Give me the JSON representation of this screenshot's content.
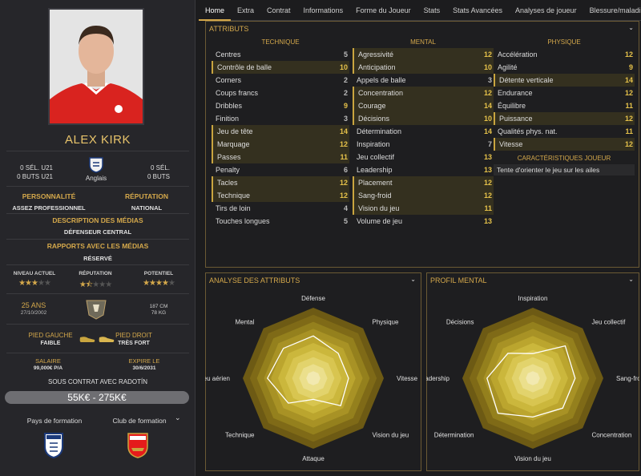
{
  "player": {
    "name": "ALEX KIRK",
    "nationality": "Anglais",
    "u21_caps": "0 SÉL. U21",
    "u21_goals": "0 BUTS U21",
    "caps": "0 SÉL.",
    "goals": "0 BUTS"
  },
  "personality": {
    "label": "PERSONNALITÉ",
    "value": "ASSEZ PROFESSIONNEL"
  },
  "reputation": {
    "label": "RÉPUTATION",
    "value": "NATIONAL"
  },
  "media_desc": {
    "label": "DESCRIPTION DES MÉDIAS",
    "value": "DÉFENSEUR CENTRAL"
  },
  "media_rel": {
    "label": "RAPPORTS AVEC LES MÉDIAS",
    "value": "RÉSERVÉ"
  },
  "ratings": {
    "current_label": "NIVEAU ACTUEL",
    "current_stars": 3,
    "rep_label": "RÉPUTATION",
    "rep_stars": 1.5,
    "potential_label": "POTENTIEL",
    "potential_stars": 4
  },
  "bio": {
    "age": "25 ANS",
    "dob": "27/10/2002",
    "height": "187 CM",
    "weight": "78 KG"
  },
  "feet": {
    "left_label": "PIED GAUCHE",
    "left_value": "FAIBLE",
    "right_label": "PIED DROIT",
    "right_value": "TRÈS FORT"
  },
  "contract": {
    "salary_label": "SALAIRE",
    "salary_value": "99,000€ P/A",
    "expiry_label": "EXPIRE LE",
    "expiry_value": "30/6/2031",
    "club_line": "SOUS CONTRAT AVEC RADOTÍN",
    "value_range": "55K€ - 275K€"
  },
  "formation": {
    "country_label": "Pays de formation",
    "club_label": "Club de formation"
  },
  "tabs": [
    "Home",
    "Extra",
    "Contrat",
    "Informations",
    "Forme du Joueur",
    "Stats",
    "Stats Avancées",
    "Analyses de joueur",
    "Blessure/maladie"
  ],
  "attributes": {
    "title": "ATTRIBUTS",
    "technical_title": "TECHNIQUE",
    "mental_title": "MENTAL",
    "physical_title": "PHYSIQUE",
    "technical": [
      [
        "Centres",
        5,
        0
      ],
      [
        "Contrôle de balle",
        10,
        1
      ],
      [
        "Corners",
        2,
        0
      ],
      [
        "Coups francs",
        2,
        0
      ],
      [
        "Dribbles",
        9,
        0
      ],
      [
        "Finition",
        3,
        0
      ],
      [
        "Jeu de tête",
        14,
        1
      ],
      [
        "Marquage",
        12,
        1
      ],
      [
        "Passes",
        11,
        1
      ],
      [
        "Penalty",
        6,
        0
      ],
      [
        "Tacles",
        12,
        1
      ],
      [
        "Technique",
        12,
        1
      ],
      [
        "Tirs de loin",
        4,
        0
      ],
      [
        "Touches longues",
        5,
        0
      ]
    ],
    "mental": [
      [
        "Agressivité",
        12,
        1
      ],
      [
        "Anticipation",
        10,
        1
      ],
      [
        "Appels de balle",
        3,
        0
      ],
      [
        "Concentration",
        12,
        1
      ],
      [
        "Courage",
        14,
        1
      ],
      [
        "Décisions",
        10,
        1
      ],
      [
        "Détermination",
        14,
        0
      ],
      [
        "Inspiration",
        7,
        0
      ],
      [
        "Jeu collectif",
        13,
        0
      ],
      [
        "Leadership",
        13,
        0
      ],
      [
        "Placement",
        12,
        1
      ],
      [
        "Sang-froid",
        12,
        1
      ],
      [
        "Vision du jeu",
        11,
        1
      ],
      [
        "Volume de jeu",
        13,
        0
      ]
    ],
    "physical": [
      [
        "Accélération",
        12,
        0
      ],
      [
        "Agilité",
        9,
        0
      ],
      [
        "Détente verticale",
        14,
        1
      ],
      [
        "Endurance",
        12,
        0
      ],
      [
        "Équilibre",
        11,
        0
      ],
      [
        "Puissance",
        12,
        1
      ],
      [
        "Qualités phys. nat.",
        11,
        0
      ],
      [
        "Vitesse",
        12,
        1
      ]
    ],
    "traits_title": "CARACTÉRISTIQUES JOUEUR",
    "traits": [
      "Tente d'orienter le jeu sur les ailes"
    ]
  },
  "radar1": {
    "title": "ANALYSE DES ATTRIBUTS",
    "labels": [
      "Défense",
      "Physique",
      "Vitesse",
      "Vision du jeu",
      "Attaque",
      "Technique",
      "Jeu aérien",
      "Mental"
    ],
    "values": [
      12,
      10,
      10,
      11,
      6,
      10,
      13,
      12
    ]
  },
  "radar2": {
    "title": "PROFIL MENTAL",
    "labels": [
      "Inspiration",
      "Jeu collectif",
      "Sang-froid",
      "Concentration",
      "Vision du jeu",
      "Détermination",
      "Leadership",
      "Décisions"
    ],
    "values": [
      7,
      13,
      12,
      12,
      11,
      14,
      13,
      10
    ]
  },
  "colors": {
    "accent": "#d4a84b",
    "highlight": "#34301f"
  }
}
